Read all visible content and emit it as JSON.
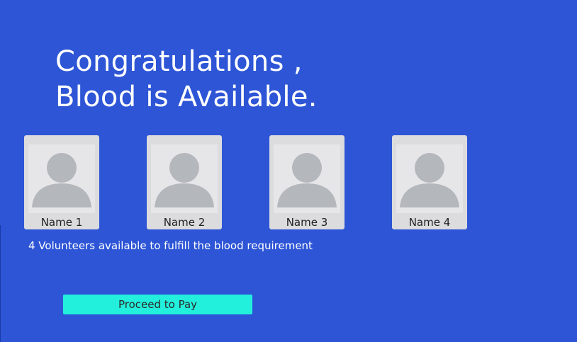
{
  "colors": {
    "background": "#2d55d6",
    "button": "#22f0dc",
    "card": "#dcdcdf",
    "avatar": "#b4b7bc"
  },
  "header": {
    "line1": "Congratulations ,",
    "line2": "Blood is Available."
  },
  "volunteers": [
    {
      "name": "Name 1",
      "icon": "user-silhouette-icon"
    },
    {
      "name": "Name 2",
      "icon": "user-silhouette-icon"
    },
    {
      "name": "Name 3",
      "icon": "user-silhouette-icon"
    },
    {
      "name": "Name 4",
      "icon": "user-silhouette-icon"
    }
  ],
  "status_text": "4 Volunteers available to fulfill the blood requirement",
  "actions": {
    "proceed_label": "Proceed to Pay"
  }
}
